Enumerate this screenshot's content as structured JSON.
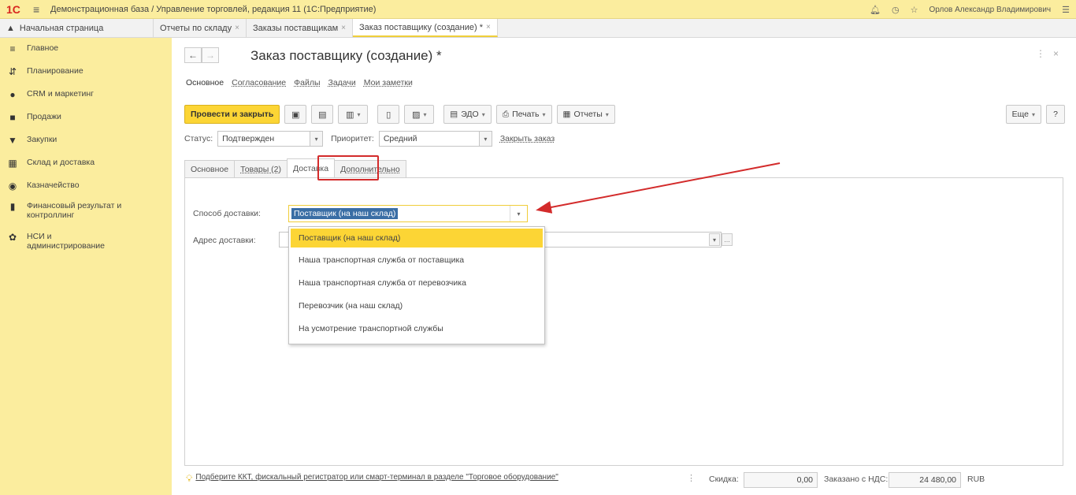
{
  "app": {
    "logo": "1С",
    "title": "Демонстрационная база / Управление торговлей, редакция 11  (1С:Предприятие)",
    "user": "Орлов Александр Владимирович"
  },
  "tabs": {
    "home": "Начальная страница",
    "items": [
      {
        "label": "Отчеты по складу"
      },
      {
        "label": "Заказы поставщикам"
      },
      {
        "label": "Заказ поставщику (создание) *"
      }
    ]
  },
  "sidebar": {
    "items": [
      {
        "label": "Главное",
        "icon": "menu-icon"
      },
      {
        "label": "Планирование",
        "icon": "planning-icon"
      },
      {
        "label": "CRM и маркетинг",
        "icon": "crm-icon"
      },
      {
        "label": "Продажи",
        "icon": "sales-icon"
      },
      {
        "label": "Закупки",
        "icon": "purchases-icon"
      },
      {
        "label": "Склад и доставка",
        "icon": "warehouse-icon"
      },
      {
        "label": "Казначейство",
        "icon": "treasury-icon"
      },
      {
        "label": "Финансовый результат и контроллинг",
        "icon": "finance-icon"
      },
      {
        "label": "НСИ и администрирование",
        "icon": "settings-icon"
      }
    ]
  },
  "document": {
    "title": "Заказ поставщику (создание) *",
    "sections": [
      "Основное",
      "Согласование",
      "Файлы",
      "Задачи",
      "Мои заметки"
    ]
  },
  "toolbar": {
    "post_close": "Провести и закрыть",
    "edo": "ЭДО",
    "print": "Печать",
    "reports": "Отчеты",
    "more": "Еще",
    "help": "?"
  },
  "status": {
    "status_label": "Статус:",
    "status_value": "Подтвержден",
    "priority_label": "Приоритет:",
    "priority_value": "Средний",
    "close_order": "Закрыть заказ"
  },
  "form_tabs": [
    "Основное",
    "Товары (2)",
    "Доставка",
    "Дополнительно"
  ],
  "delivery": {
    "method_label": "Способ доставки:",
    "method_value": "Поставщик (на наш склад)",
    "address_label": "Адрес доставки:",
    "options": [
      "Поставщик (на наш склад)",
      "Наша транспортная служба от поставщика",
      "Наша транспортная служба от перевозчика",
      "Перевозчик (на наш склад)",
      "На усмотрение транспортной службы"
    ]
  },
  "footer": {
    "hint": "Подберите ККТ, фискальный регистратор или смарт-терминал в разделе \"Торговое оборудование\"",
    "discount_label": "Скидка:",
    "discount_value": "0,00",
    "total_label": "Заказано с НДС:",
    "total_value": "24 480,00",
    "currency": "RUB"
  },
  "colors": {
    "accent": "#fcd535",
    "sidebar_bg": "#fbed9e",
    "highlight": "#d32b2b"
  }
}
